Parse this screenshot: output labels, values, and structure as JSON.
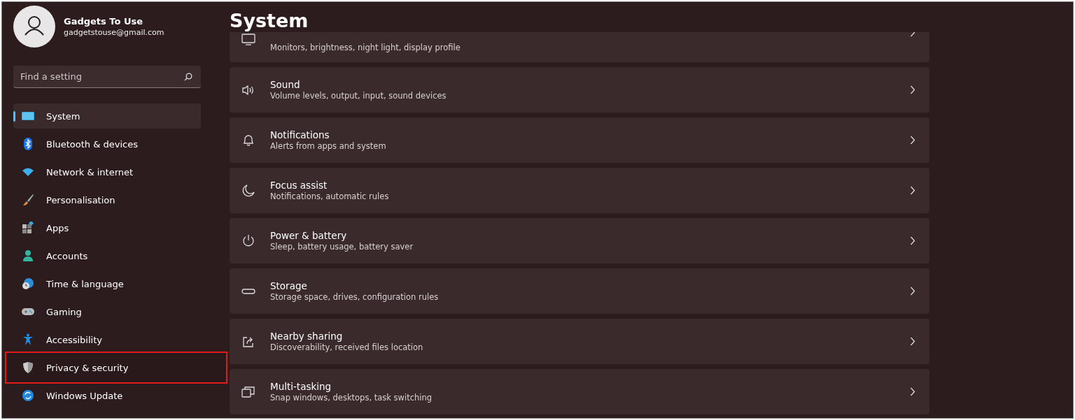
{
  "account": {
    "name": "Gadgets To Use",
    "email": "gadgetstouse@gmail.com"
  },
  "search": {
    "placeholder": "Find a setting"
  },
  "nav": [
    {
      "label": "System",
      "kind": "system",
      "selected": true,
      "highlighted": false
    },
    {
      "label": "Bluetooth & devices",
      "kind": "bluetooth",
      "selected": false,
      "highlighted": false
    },
    {
      "label": "Network & internet",
      "kind": "wifi",
      "selected": false,
      "highlighted": false
    },
    {
      "label": "Personalisation",
      "kind": "brush",
      "selected": false,
      "highlighted": false
    },
    {
      "label": "Apps",
      "kind": "apps",
      "selected": false,
      "highlighted": false
    },
    {
      "label": "Accounts",
      "kind": "person",
      "selected": false,
      "highlighted": false
    },
    {
      "label": "Time & language",
      "kind": "globe",
      "selected": false,
      "highlighted": false
    },
    {
      "label": "Gaming",
      "kind": "gamepad",
      "selected": false,
      "highlighted": false
    },
    {
      "label": "Accessibility",
      "kind": "accessibility",
      "selected": false,
      "highlighted": false
    },
    {
      "label": "Privacy & security",
      "kind": "shield",
      "selected": false,
      "highlighted": true
    },
    {
      "label": "Windows Update",
      "kind": "update",
      "selected": false,
      "highlighted": false
    }
  ],
  "page": {
    "title": "System"
  },
  "cards": [
    {
      "kind": "display",
      "subtitle": "Monitors, brightness, night light, display profile"
    },
    {
      "kind": "sound",
      "title": "Sound",
      "subtitle": "Volume levels, output, input, sound devices"
    },
    {
      "kind": "bell",
      "title": "Notifications",
      "subtitle": "Alerts from apps and system"
    },
    {
      "kind": "moon",
      "title": "Focus assist",
      "subtitle": "Notifications, automatic rules"
    },
    {
      "kind": "power",
      "title": "Power & battery",
      "subtitle": "Sleep, battery usage, battery saver"
    },
    {
      "kind": "storage",
      "title": "Storage",
      "subtitle": "Storage space, drives, configuration rules"
    },
    {
      "kind": "share",
      "title": "Nearby sharing",
      "subtitle": "Discoverability, received files location"
    },
    {
      "kind": "multitask",
      "title": "Multi-tasking",
      "subtitle": "Snap windows, desktops, task switching"
    }
  ]
}
